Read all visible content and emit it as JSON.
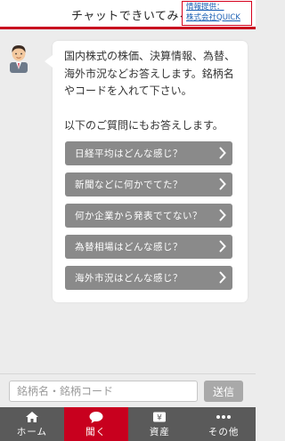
{
  "header": {
    "title": "チャットできいてみる",
    "source_line1": "情報提供：",
    "source_line2": "株式会社QUICK"
  },
  "chat": {
    "message": "国内株式の株価、決算情報、為替、海外市況などお答えします。銘柄名やコードを入れて下さい。",
    "sub_message": "以下のご質問にもお答えします。",
    "questions": [
      {
        "label": "日経平均はどんな感じ？"
      },
      {
        "label": "新聞などに何かでてた？"
      },
      {
        "label": "何か企業から発表でてない？"
      },
      {
        "label": "為替相場はどんな感じ？"
      },
      {
        "label": "海外市況はどんな感じ？"
      }
    ]
  },
  "input": {
    "placeholder": "銘柄名・銘柄コード",
    "value": "",
    "send_label": "送信"
  },
  "nav": {
    "items": [
      {
        "label": "ホーム",
        "icon": "home-icon",
        "active": false
      },
      {
        "label": "聞く",
        "icon": "chat-icon",
        "active": true
      },
      {
        "label": "資産",
        "icon": "yen-wallet-icon",
        "active": false
      },
      {
        "label": "その他",
        "icon": "more-icon",
        "active": false
      }
    ]
  },
  "colors": {
    "accent": "#c8001e",
    "source_border": "#d6001c",
    "link": "#1a5fb4",
    "question_button": "#8a8a8a",
    "nav_bg": "#5a5a5a",
    "page_bg": "#ececec"
  }
}
